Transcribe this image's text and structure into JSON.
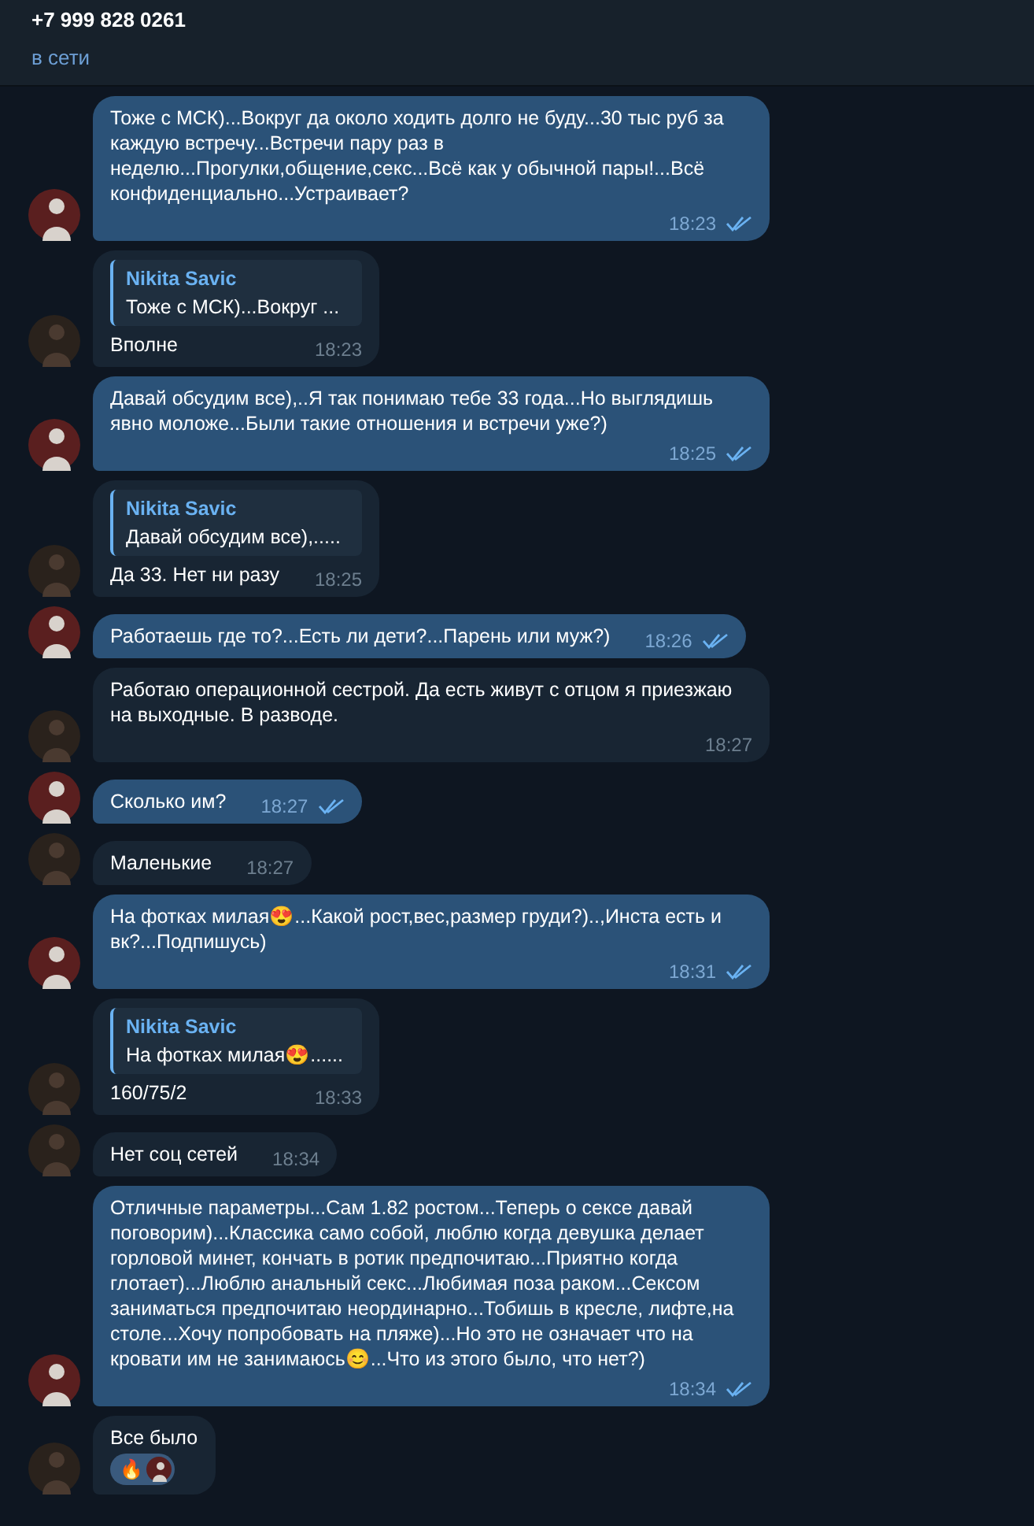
{
  "header": {
    "title": "+7 999 828 0261",
    "status": "в сети"
  },
  "messages": [
    {
      "kind": "out",
      "text": "Тоже с МСК)...Вокруг да около ходить долго не буду...30 тыс руб за каждую встречу...Встречи пару раз в неделю...Прогулки,общение,секс...Всё как у обычной пары!...Всё конфиденциально...Устраивает?",
      "time": "18:23",
      "read": true
    },
    {
      "kind": "in",
      "reply": {
        "author": "Nikita Savic",
        "text": "Тоже с МСК)...Вокруг ..."
      },
      "text": "Вполне",
      "time": "18:23"
    },
    {
      "kind": "out",
      "text": "Давай обсудим все),..Я так понимаю тебе 33 года...Но выглядишь явно моложе...Были такие отношения и встречи уже?)",
      "time": "18:25",
      "read": true
    },
    {
      "kind": "in",
      "reply": {
        "author": "Nikita Savic",
        "text": "Давай обсудим все),....."
      },
      "text": "Да 33. Нет ни разу",
      "time": "18:25"
    },
    {
      "kind": "out",
      "text": "Работаешь где то?...Есть ли дети?...Парень или муж?)",
      "time": "18:26",
      "read": true
    },
    {
      "kind": "in",
      "text": "Работаю операционной сестрой. Да есть живут с отцом я приезжаю на выходные. В разводе.",
      "time": "18:27"
    },
    {
      "kind": "out",
      "text": "Сколько им?",
      "time": "18:27",
      "read": true
    },
    {
      "kind": "in",
      "text": "Маленькие",
      "time": "18:27"
    },
    {
      "kind": "out",
      "text": "На фотках милая😍...Какой рост,вес,размер груди?)..,Инста есть и вк?...Подпишусь)",
      "time": "18:31",
      "read": true
    },
    {
      "kind": "in",
      "reply": {
        "author": "Nikita Savic",
        "text": "На фотках милая😍......"
      },
      "text": "160/75/2",
      "time": "18:33"
    },
    {
      "kind": "in",
      "text": "Нет соц сетей",
      "time": "18:34"
    },
    {
      "kind": "out",
      "text": "Отличные параметры...Сам 1.82 ростом...Теперь о сексе давай поговорим)...Классика само собой, люблю когда девушка делает горловой минет, кончать в ротик предпочитаю...Приятно когда глотает)...Люблю анальный секс...Любимая поза раком...Сексом заниматься предпочитаю неординарно...Тобишь в кресле, лифте,на столе...Хочу попробовать на пляже)...Но это не означает что на кровати им не занимаюсь😊...Что из этого было, что нет?)",
      "time": "18:34",
      "read": true
    },
    {
      "kind": "in",
      "text": "Все было",
      "reaction": "🔥"
    }
  ]
}
